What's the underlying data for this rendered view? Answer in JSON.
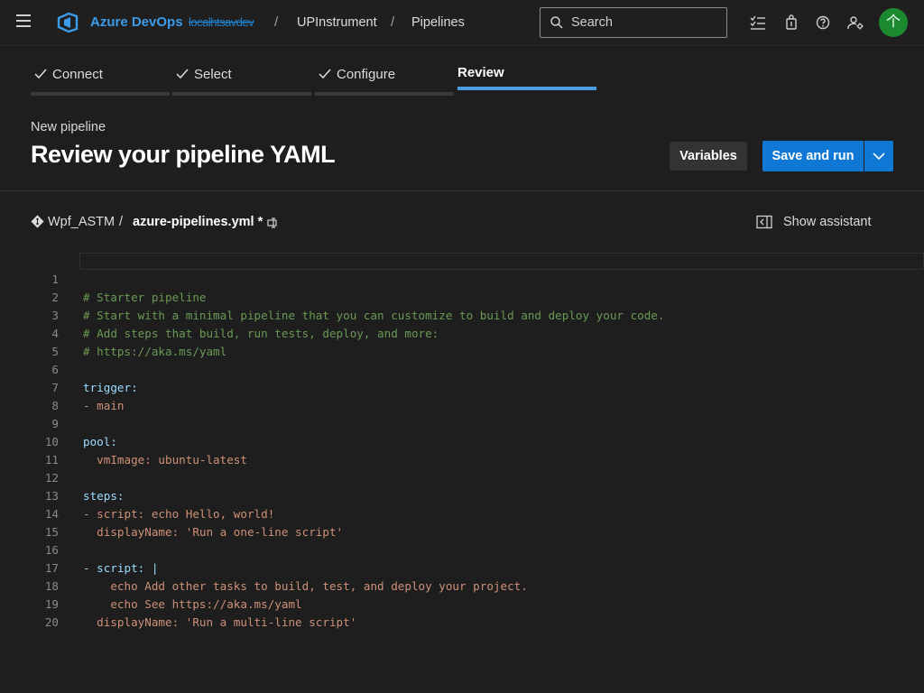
{
  "topbar": {
    "brand": "Azure DevOps",
    "organization": "localhtsavdev",
    "project": "UPInstrument",
    "section": "Pipelines",
    "search_placeholder": "Search",
    "avatar_initial": "个"
  },
  "wizard": {
    "steps": [
      {
        "label": "Connect",
        "done": true
      },
      {
        "label": "Select",
        "done": true
      },
      {
        "label": "Configure",
        "done": true
      },
      {
        "label": "Review",
        "done": false
      }
    ]
  },
  "header": {
    "subtitle": "New pipeline",
    "title": "Review your pipeline YAML",
    "variables_label": "Variables",
    "save_label": "Save and run"
  },
  "file": {
    "repo": "Wpf_ASTM",
    "separator": "/",
    "name": "azure-pipelines.yml *",
    "assistant_label": "Show assistant"
  },
  "editor": {
    "lines": [
      {
        "n": "1",
        "t": "# Starter pipeline"
      },
      {
        "n": "2",
        "t": "# Start with a minimal pipeline that you can customize to build and deploy your code."
      },
      {
        "n": "3",
        "t": "# Add steps that build, run tests, deploy, and more:"
      },
      {
        "n": "4",
        "t": "# https://aka.ms/yaml"
      },
      {
        "n": "5",
        "t": ""
      },
      {
        "n": "6",
        "t": "trigger:"
      },
      {
        "n": "7",
        "t": "- main"
      },
      {
        "n": "8",
        "t": ""
      },
      {
        "n": "9",
        "t": "pool:"
      },
      {
        "n": "10",
        "t": "  vmImage: ubuntu-latest"
      },
      {
        "n": "11",
        "t": ""
      },
      {
        "n": "12",
        "t": "steps:"
      },
      {
        "n": "13",
        "t": "- script: echo Hello, world!"
      },
      {
        "n": "14",
        "t": "  displayName: 'Run a one-line script'"
      },
      {
        "n": "15",
        "t": ""
      },
      {
        "n": "16",
        "t": "- script: |"
      },
      {
        "n": "17",
        "t": "    echo Add other tasks to build, test, and deploy your project."
      },
      {
        "n": "18",
        "t": "    echo See https://aka.ms/yaml"
      },
      {
        "n": "19",
        "t": "  displayName: 'Run a multi-line script'"
      },
      {
        "n": "20",
        "t": ""
      }
    ]
  },
  "colors": {
    "accent": "#0f78d4",
    "comment": "#6a9955",
    "key": "#9cdcfe",
    "string": "#ce9178",
    "avatar": "#1b8a2f"
  }
}
